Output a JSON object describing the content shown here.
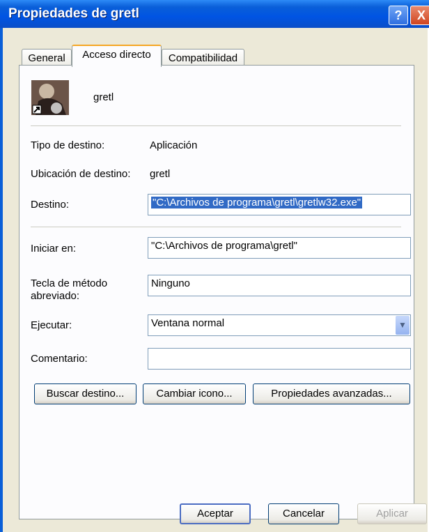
{
  "window": {
    "title": "Propiedades de gretl",
    "help": "?",
    "close": "X"
  },
  "tabs": [
    {
      "label": "General"
    },
    {
      "label": "Acceso directo"
    },
    {
      "label": "Compatibilidad"
    }
  ],
  "shortcut": {
    "name": "gretl",
    "tipo_label": "Tipo de destino:",
    "tipo_value": "Aplicación",
    "ubicacion_label": "Ubicación de destino:",
    "ubicacion_value": "gretl",
    "destino_label": "Destino:",
    "destino_value": "\"C:\\Archivos de programa\\gretl\\gretlw32.exe\"",
    "iniciar_label": "Iniciar en:",
    "iniciar_value": "\"C:\\Archivos de programa\\gretl\"",
    "tecla_label_1": "Tecla de método",
    "tecla_label_2": "abreviado:",
    "tecla_value": "Ninguno",
    "ejecutar_label": "Ejecutar:",
    "ejecutar_value": "Ventana normal",
    "comentario_label": "Comentario:",
    "comentario_value": ""
  },
  "action_buttons": {
    "buscar": "Buscar destino...",
    "cambiar": "Cambiar icono...",
    "avanzadas": "Propiedades avanzadas..."
  },
  "footer": {
    "ok": "Aceptar",
    "cancel": "Cancelar",
    "apply": "Aplicar"
  }
}
